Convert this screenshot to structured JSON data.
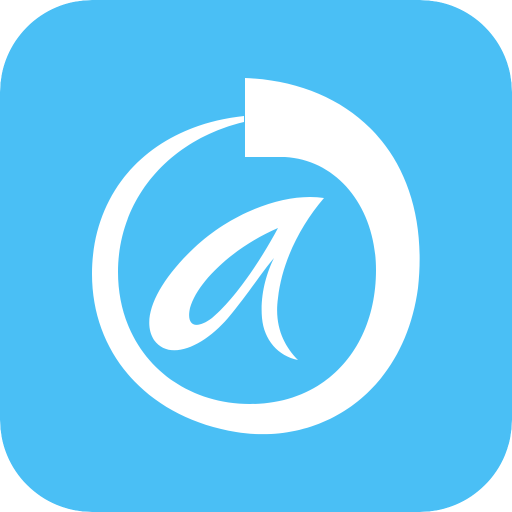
{
  "app_icon": {
    "icon": "swirl-letter-a-logo-icon",
    "colors": {
      "background": "#4ABFF5",
      "foreground": "#FFFFFF"
    }
  }
}
